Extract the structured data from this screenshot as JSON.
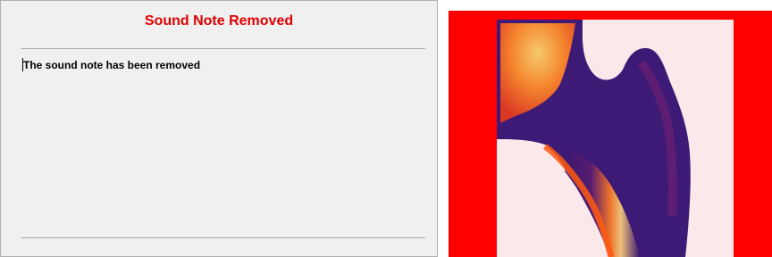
{
  "dialog": {
    "title": "Sound Note Removed",
    "message": "The sound note has been removed"
  },
  "image_panel": {
    "icon": "bone-density-heatmap-image"
  },
  "colors": {
    "title": "#e00000",
    "panel_background": "#f0f0f0",
    "image_frame": "#ff0000",
    "image_background": "#fbe8ea",
    "bone_core": "#3a1870",
    "bone_edge": "#ff6010"
  }
}
